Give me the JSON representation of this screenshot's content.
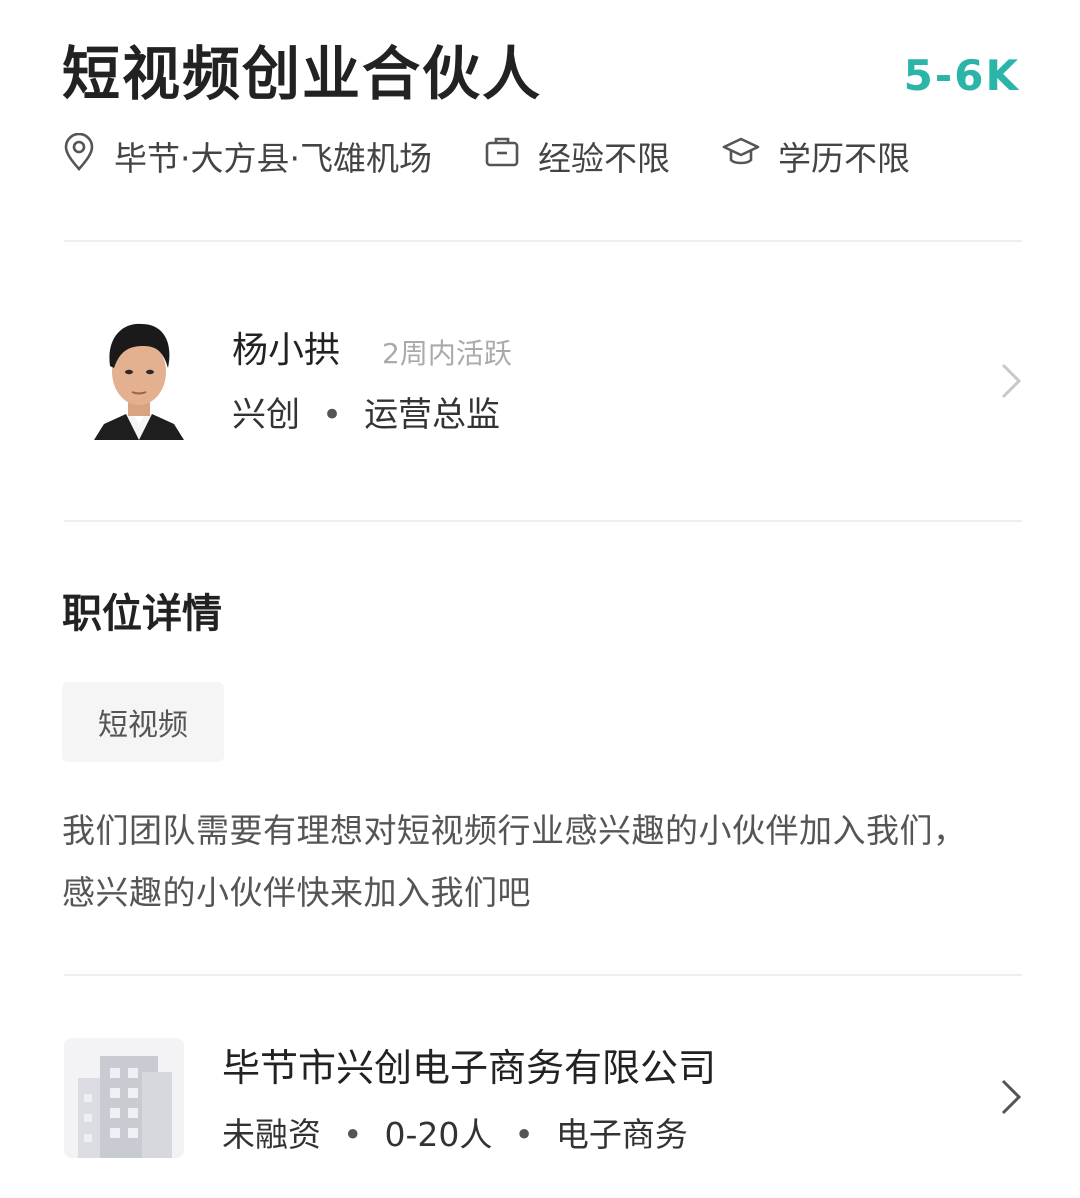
{
  "job": {
    "title": "短视频创业合伙人",
    "salary": "5-6K",
    "location": "毕节·大方县·飞雄机场",
    "experience": "经验不限",
    "education": "学历不限"
  },
  "recruiter": {
    "name": "杨小拱",
    "active_status": "2周内活跃",
    "company_short": "兴创",
    "separator": "•",
    "position": "运营总监"
  },
  "details": {
    "section_title": "职位详情",
    "tag": "短视频",
    "description": "我们团队需要有理想对短视频行业感兴趣的小伙伴加入我们，感兴趣的小伙伴快来加入我们吧"
  },
  "company": {
    "name": "毕节市兴创电子商务有限公司",
    "funding": "未融资",
    "separator": "•",
    "size": "0-20人",
    "industry": "电子商务"
  },
  "icons": {
    "location": "location-pin-icon",
    "experience": "briefcase-icon",
    "education": "graduation-cap-icon",
    "chevron": "chevron-right-icon",
    "company_logo": "building-icon"
  },
  "colors": {
    "salary": "#2bb5a8",
    "divider": "#eeeeee"
  }
}
